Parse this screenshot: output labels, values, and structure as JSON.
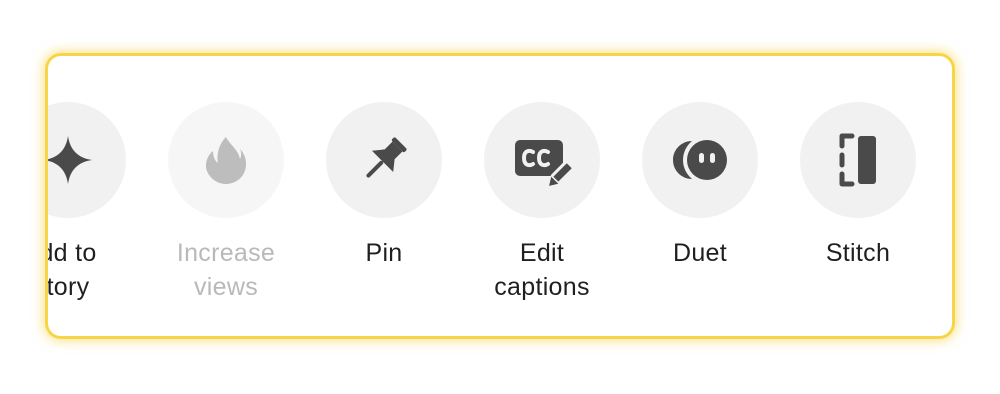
{
  "actions": [
    {
      "name": "add-to-story",
      "icon": "sparkle-icon",
      "lines": [
        "dd to",
        "tory"
      ],
      "enabled": true
    },
    {
      "name": "increase-views",
      "icon": "flame-icon",
      "lines": [
        "Increase",
        "views"
      ],
      "enabled": false
    },
    {
      "name": "pin",
      "icon": "pin-icon",
      "lines": [
        "Pin",
        ""
      ],
      "enabled": true
    },
    {
      "name": "edit-captions",
      "icon": "captions-icon",
      "lines": [
        "Edit",
        "captions"
      ],
      "enabled": true
    },
    {
      "name": "duet",
      "icon": "duet-icon",
      "lines": [
        "Duet",
        ""
      ],
      "enabled": true
    },
    {
      "name": "stitch",
      "icon": "stitch-icon",
      "lines": [
        "Stitch",
        ""
      ],
      "enabled": true
    }
  ],
  "colors": {
    "border": "#f7d54a",
    "icon": "#4a4a4a",
    "icon_disabled": "#bdbdbd",
    "circle": "#f1f1f1",
    "text": "#1f1f1f",
    "text_disabled": "#b9b9b9"
  }
}
